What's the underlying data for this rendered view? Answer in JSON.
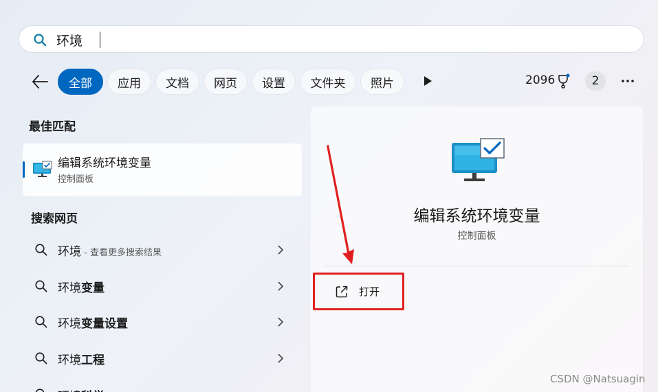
{
  "search": {
    "query": "环境"
  },
  "filters": {
    "back_icon": "back-arrow-icon",
    "chips": [
      "全部",
      "应用",
      "文档",
      "网页",
      "设置",
      "文件夹",
      "照片"
    ],
    "active_index": 0,
    "points": "2096",
    "badge_count": "2"
  },
  "best_match": {
    "heading": "最佳匹配",
    "title": "编辑系统环境变量",
    "subtitle": "控制面板"
  },
  "web_search": {
    "heading": "搜索网页",
    "items": [
      {
        "plain": "环境",
        "bold": "",
        "hint": " - 查看更多搜索结果"
      },
      {
        "plain": "环境",
        "bold": "变量",
        "hint": ""
      },
      {
        "plain": "环境",
        "bold": "变量设置",
        "hint": ""
      },
      {
        "plain": "环境",
        "bold": "工程",
        "hint": ""
      },
      {
        "plain": "环境",
        "bold": "科学",
        "hint": ""
      }
    ]
  },
  "detail": {
    "title": "编辑系统环境变量",
    "category": "控制面板",
    "actions": [
      {
        "label": "打开"
      }
    ]
  },
  "watermark": "CSDN @Natsuagin",
  "colors": {
    "accent": "#0067c0",
    "highlight": "#e02020"
  }
}
